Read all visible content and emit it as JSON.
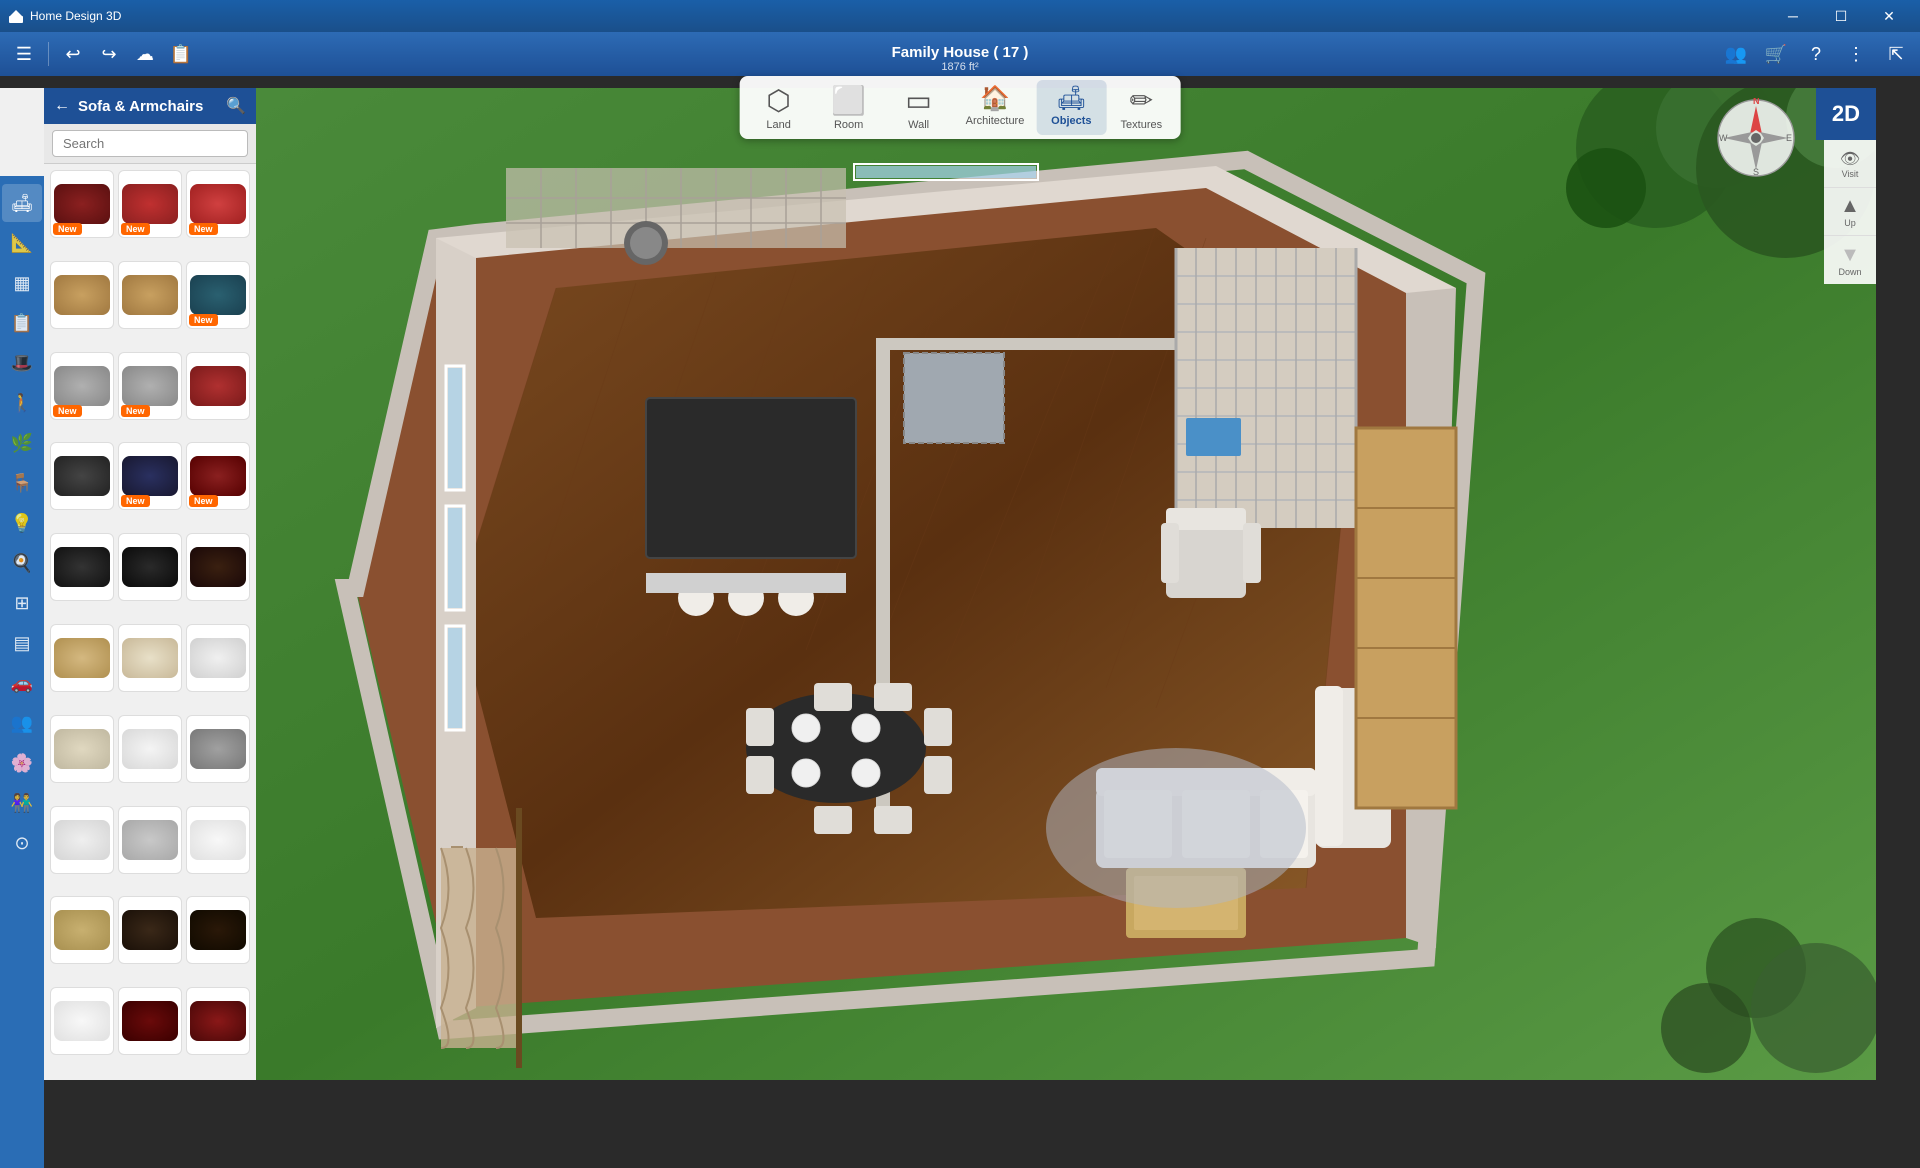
{
  "titlebar": {
    "app_name": "Home Design 3D",
    "window_controls": [
      "minimize",
      "maximize",
      "close"
    ]
  },
  "toolbar": {
    "buttons": [
      "menu",
      "undo",
      "redo",
      "cloud",
      "import"
    ]
  },
  "center_tabs": {
    "items": [
      {
        "id": "land",
        "label": "Land",
        "icon": "⬡"
      },
      {
        "id": "room",
        "label": "Room",
        "icon": "⬜"
      },
      {
        "id": "wall",
        "label": "Wall",
        "icon": "▭"
      },
      {
        "id": "architecture",
        "label": "Architecture",
        "icon": "🏠"
      },
      {
        "id": "objects",
        "label": "Objects",
        "icon": "🛋"
      },
      {
        "id": "textures",
        "label": "Textures",
        "icon": "✏"
      }
    ],
    "active": "objects"
  },
  "window": {
    "title": "Family House ( 17 )",
    "subtitle": "1876 ft²"
  },
  "sidebar": {
    "category": "Sofa & Armchairs",
    "search_placeholder": "Search",
    "items": [
      {
        "id": 1,
        "color": "fi-red-dark",
        "badge": "New"
      },
      {
        "id": 2,
        "color": "fi-red-med",
        "badge": "New"
      },
      {
        "id": 3,
        "color": "fi-red-bright",
        "badge": "New"
      },
      {
        "id": 4,
        "color": "fi-tan",
        "badge": ""
      },
      {
        "id": 5,
        "color": "fi-tan",
        "badge": ""
      },
      {
        "id": 6,
        "color": "fi-teal",
        "badge": "New"
      },
      {
        "id": 7,
        "color": "fi-gray-lt",
        "badge": "New"
      },
      {
        "id": 8,
        "color": "fi-gray-lt",
        "badge": "New"
      },
      {
        "id": 9,
        "color": "fi-red-sofa",
        "badge": ""
      },
      {
        "id": 10,
        "color": "fi-dk-gray",
        "badge": ""
      },
      {
        "id": 11,
        "color": "fi-dk-navy",
        "badge": "New"
      },
      {
        "id": 12,
        "color": "fi-dk-red",
        "badge": "New"
      },
      {
        "id": 13,
        "color": "fi-black",
        "badge": ""
      },
      {
        "id": 14,
        "color": "fi-black2",
        "badge": ""
      },
      {
        "id": 15,
        "color": "fi-dk-brown",
        "badge": ""
      },
      {
        "id": 16,
        "color": "fi-tan-lt",
        "badge": ""
      },
      {
        "id": 17,
        "color": "fi-cream",
        "badge": ""
      },
      {
        "id": 18,
        "color": "fi-white",
        "badge": ""
      },
      {
        "id": 19,
        "color": "fi-cream2",
        "badge": ""
      },
      {
        "id": 20,
        "color": "fi-white2",
        "badge": ""
      },
      {
        "id": 21,
        "color": "fi-gray2",
        "badge": ""
      },
      {
        "id": 22,
        "color": "fi-white3",
        "badge": ""
      },
      {
        "id": 23,
        "color": "fi-lt-gray",
        "badge": ""
      },
      {
        "id": 24,
        "color": "fi-white4",
        "badge": ""
      },
      {
        "id": 25,
        "color": "fi-tan2",
        "badge": ""
      },
      {
        "id": 26,
        "color": "fi-dk-br2",
        "badge": ""
      },
      {
        "id": 27,
        "color": "fi-dk-br3",
        "badge": ""
      },
      {
        "id": 28,
        "color": "fi-maroon",
        "badge": ""
      }
    ]
  },
  "nav_icons": [
    {
      "id": "sofa",
      "icon": "🛋",
      "active": true
    },
    {
      "id": "tools",
      "icon": "📐"
    },
    {
      "id": "grid",
      "icon": "▦"
    },
    {
      "id": "layers",
      "icon": "📋"
    },
    {
      "id": "hat",
      "icon": "🎩"
    },
    {
      "id": "figure",
      "icon": "🚶"
    },
    {
      "id": "plant",
      "icon": "🌿"
    },
    {
      "id": "chair",
      "icon": "🪑"
    },
    {
      "id": "lamp",
      "icon": "💡"
    },
    {
      "id": "kitchen",
      "icon": "🍳"
    },
    {
      "id": "fence",
      "icon": "⊞"
    },
    {
      "id": "stairs",
      "icon": "▤"
    },
    {
      "id": "transport",
      "icon": "🚗"
    },
    {
      "id": "people",
      "icon": "👥"
    },
    {
      "id": "flower",
      "icon": "🌸"
    },
    {
      "id": "group",
      "icon": "👫"
    },
    {
      "id": "misc",
      "icon": "⊙"
    }
  ],
  "view_controls": {
    "btn_2d": "2D",
    "compass_n": "N",
    "compass_s": "S",
    "compass_e": "E",
    "compass_w": "W",
    "btn_visit": "Visit",
    "btn_up": "Up",
    "btn_down": "Down"
  }
}
